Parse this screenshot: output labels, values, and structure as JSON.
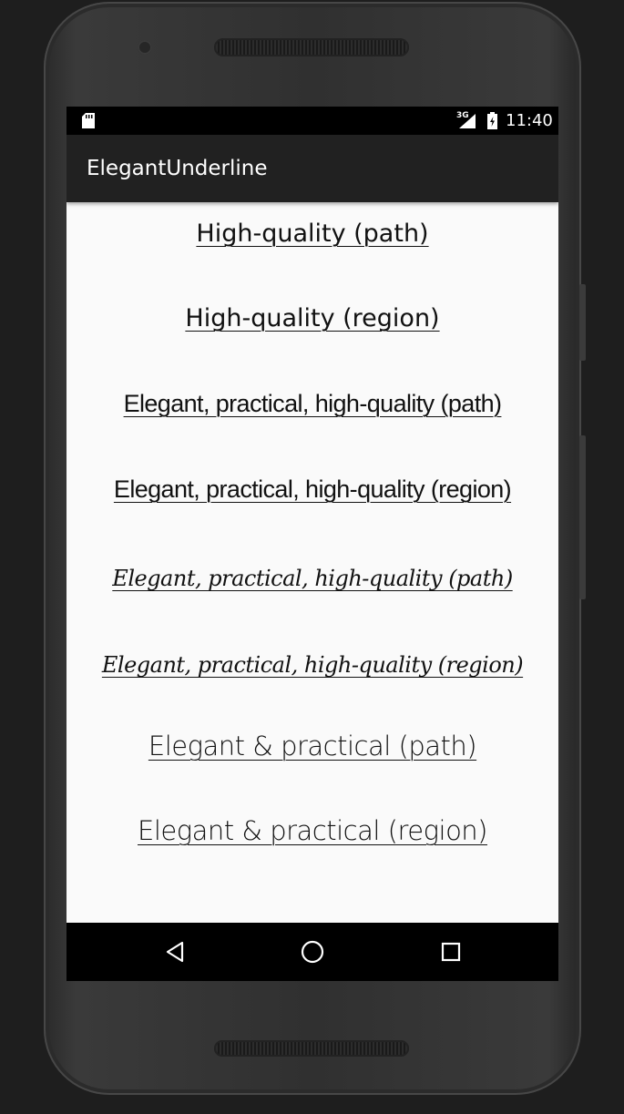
{
  "status_bar": {
    "network_label": "3G",
    "time": "11:40",
    "icons": [
      "sd-card-icon",
      "signal-icon",
      "battery-icon"
    ]
  },
  "app_bar": {
    "title": "ElegantUnderline"
  },
  "items": [
    "High-quality (path)",
    "High-quality (region)",
    "Elegant, practical, high-quality (path)",
    "Elegant, practical, high-quality (region)",
    "Elegant, practical, high-quality (path)",
    "Elegant, practical, high-quality (region)",
    "Elegant & practical (path)",
    "Elegant & practical (region)"
  ],
  "nav_bar": {
    "icons": [
      "back-icon",
      "home-icon",
      "recents-icon"
    ]
  },
  "colors": {
    "app_bar": "#212121",
    "status_bar": "#000000",
    "background": "#fafafa",
    "text": "#111111"
  }
}
